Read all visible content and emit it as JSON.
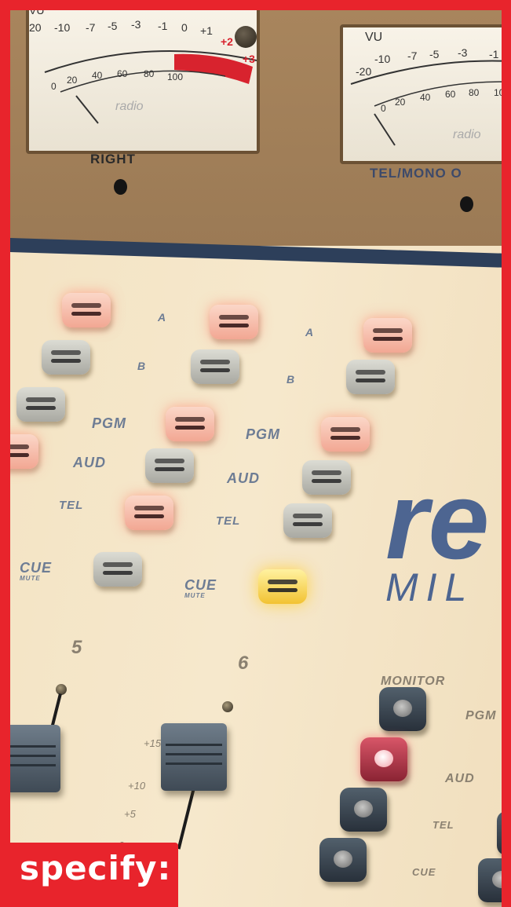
{
  "meter_left": {
    "scale_top": [
      "-10",
      "-7",
      "-5",
      "-3",
      "-1",
      "0",
      "+1",
      "+2",
      "+3"
    ],
    "scale_bottom": [
      "0",
      "20",
      "40",
      "60",
      "80",
      "100"
    ],
    "brand": "radio",
    "vu_partial": "VU",
    "left_partial": "20"
  },
  "meter_right": {
    "label": "VU",
    "scale_top": [
      "-20",
      "-10",
      "-7",
      "-5",
      "-3",
      "-1"
    ],
    "scale_bottom": [
      "0",
      "20",
      "40",
      "60",
      "80",
      "10"
    ],
    "brand": "radio"
  },
  "panel": {
    "right_label": "RIGHT",
    "tel_mono_label": "TEL/MONO O"
  },
  "buttons": {
    "a": "A",
    "b": "B",
    "pgm": "PGM",
    "aud": "AUD",
    "tel": "TEL",
    "cue": "CUE",
    "mute": "MUTE"
  },
  "brand_big": "re",
  "brand_sub": "MIL",
  "channels": [
    "5",
    "6"
  ],
  "fader_ticks": [
    "+15",
    "+10",
    "+5",
    "0"
  ],
  "monitor": {
    "title": "MONITOR",
    "items": [
      "PGM",
      "AUD",
      "TEL",
      "CUE"
    ]
  },
  "overlay_text": "specify:",
  "colors": {
    "frame": "#e8242c",
    "panel_tan": "#f3e3c3",
    "top_brown": "#a8855d",
    "label_blue": "#6d7c94"
  }
}
